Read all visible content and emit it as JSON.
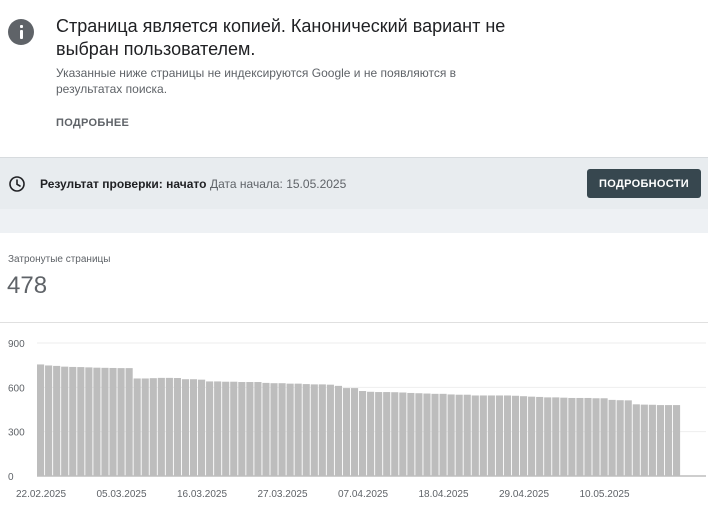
{
  "issue": {
    "icon": "info-icon",
    "title": "Страница является копией. Канонический вариант не выбран пользователем.",
    "description": "Указанные ниже страницы не индексируются Google и не появляются в результатах поиска.",
    "more_label": "ПОДРОБНЕЕ"
  },
  "validation": {
    "icon": "clock-icon",
    "status_label": "Результат проверки: начато",
    "start_date_label": "Дата начала: 15.05.2025",
    "details_label": "ПОДРОБНОСТИ",
    "details_button_color": "#37474f"
  },
  "affected": {
    "label": "Затронутые страницы",
    "count": "478"
  },
  "chart_data": {
    "type": "bar",
    "bar_color": "#bdbdbd",
    "ylim": [
      0,
      900
    ],
    "y_ticks": [
      "0",
      "300",
      "600",
      "900"
    ],
    "x_tick_labels": [
      "22.02.2025",
      "05.03.2025",
      "16.03.2025",
      "27.03.2025",
      "07.04.2025",
      "18.04.2025",
      "29.04.2025",
      "10.05.2025"
    ],
    "values": [
      755,
      748,
      745,
      740,
      738,
      737,
      735,
      733,
      732,
      731,
      730,
      730,
      660,
      660,
      662,
      664,
      664,
      663,
      655,
      655,
      652,
      640,
      640,
      638,
      638,
      636,
      636,
      636,
      630,
      628,
      628,
      625,
      625,
      622,
      620,
      620,
      618,
      610,
      595,
      595,
      575,
      570,
      568,
      568,
      567,
      565,
      562,
      560,
      558,
      556,
      556,
      552,
      550,
      550,
      545,
      545,
      545,
      545,
      545,
      543,
      540,
      537,
      535,
      532,
      532,
      530,
      528,
      528,
      528,
      526,
      526,
      515,
      513,
      512,
      485,
      483,
      482,
      480,
      480,
      480
    ]
  }
}
